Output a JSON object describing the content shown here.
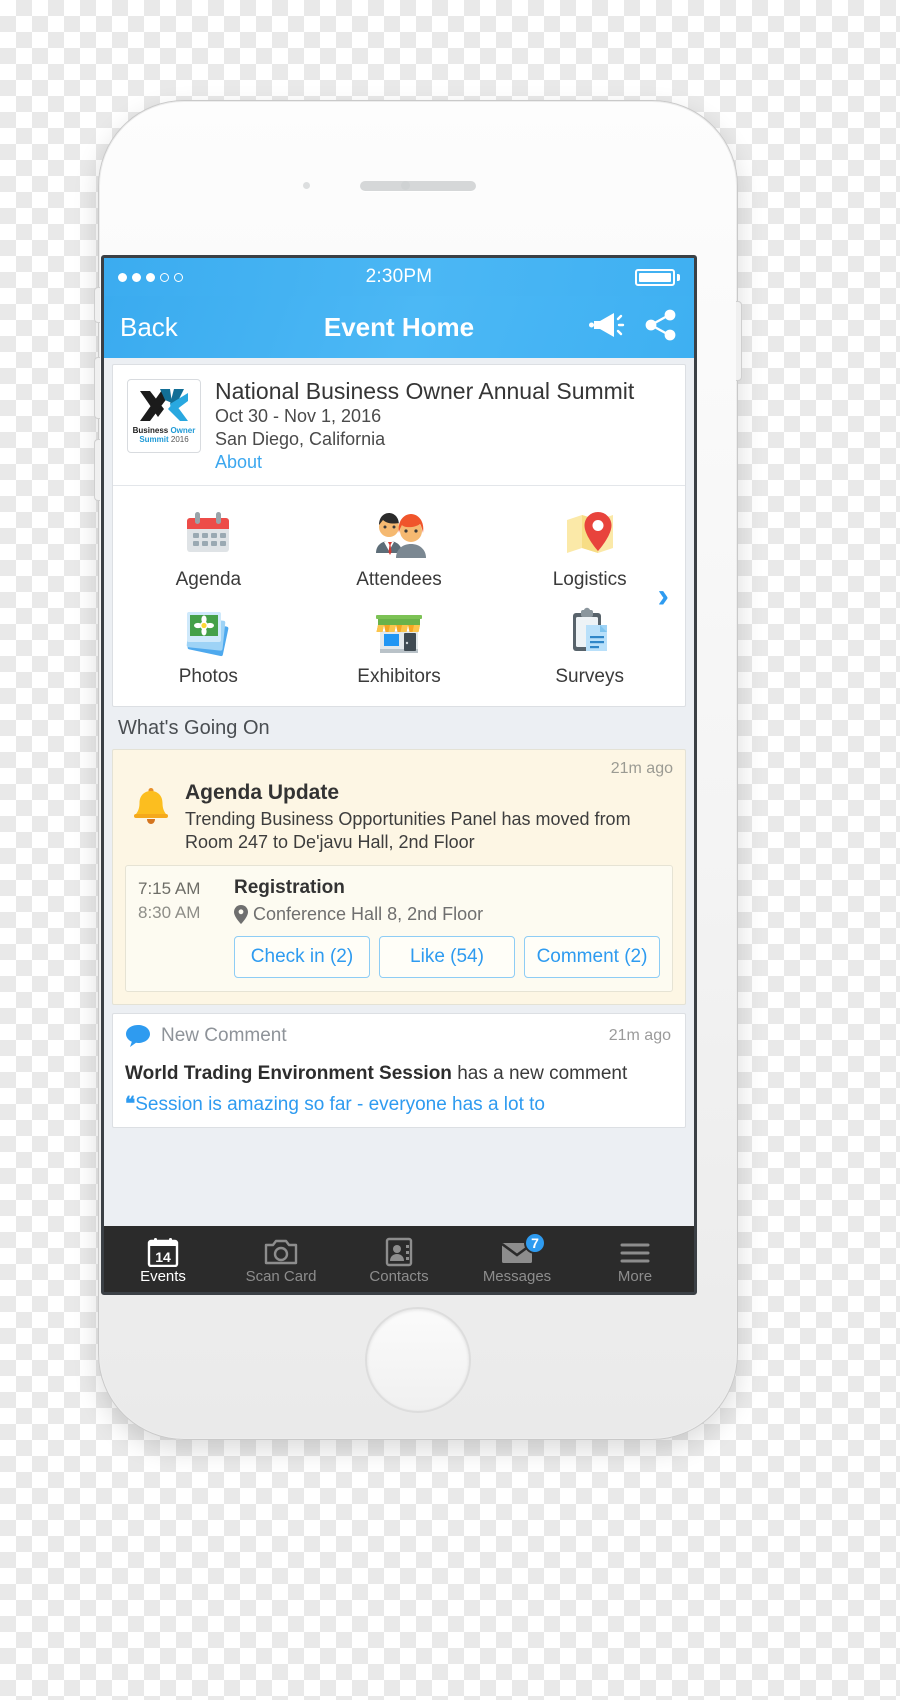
{
  "status_bar": {
    "signal_dots_filled": 3,
    "signal_dots_total": 5,
    "time": "2:30PM",
    "battery_icon": "battery-full-icon"
  },
  "nav_bar": {
    "back_label": "Back",
    "title": "Event Home",
    "announce_icon": "megaphone-icon",
    "share_icon": "share-icon"
  },
  "event": {
    "logo": {
      "icon": "business-owner-summit-logo",
      "word_business": "Business",
      "word_owner": "Owner",
      "word_summit": "Summit",
      "word_year": "2016"
    },
    "title": "National Business Owner Annual Summit",
    "dates": "Oct 30 - Nov 1, 2016",
    "location": "San Diego, California",
    "about_link": "About"
  },
  "icon_grid": {
    "next_arrow": "chevron-right-icon",
    "items": [
      {
        "label": "Agenda",
        "icon": "calendar-icon"
      },
      {
        "label": "Attendees",
        "icon": "people-icon"
      },
      {
        "label": "Logistics",
        "icon": "map-pin-icon"
      },
      {
        "label": "Photos",
        "icon": "photos-icon"
      },
      {
        "label": "Exhibitors",
        "icon": "storefront-icon"
      },
      {
        "label": "Surveys",
        "icon": "clipboard-icon"
      }
    ]
  },
  "feed": {
    "section_title": "What's Going On",
    "alert": {
      "icon": "bell-icon",
      "time_ago": "21m ago",
      "title": "Agenda Update",
      "text": "Trending Business Opportunities Panel has moved from Room 247 to De'javu Hall, 2nd Floor",
      "session": {
        "start_time": "7:15 AM",
        "end_time": "8:30 AM",
        "title": "Registration",
        "location_icon": "location-pin-icon",
        "location": "Conference Hall 8, 2nd Floor",
        "actions": [
          {
            "label": "Check in (2)"
          },
          {
            "label": "Like (54)"
          },
          {
            "label": "Comment (2)"
          }
        ]
      }
    },
    "comment": {
      "icon": "speech-bubble-icon",
      "kind": "New Comment",
      "time_ago": "21m ago",
      "subject": "World Trading Environment Session",
      "suffix": " has a new comment",
      "quote_mark": "❝",
      "quote": "Session is amazing so far - everyone has a lot to"
    }
  },
  "tab_bar": {
    "tabs": [
      {
        "label": "Events",
        "icon": "calendar-14-icon",
        "active": true,
        "badge": ""
      },
      {
        "label": "Scan Card",
        "icon": "camera-icon",
        "active": false,
        "badge": ""
      },
      {
        "label": "Contacts",
        "icon": "contact-card-icon",
        "active": false,
        "badge": ""
      },
      {
        "label": "Messages",
        "icon": "envelope-icon",
        "active": false,
        "badge": "7"
      },
      {
        "label": "More",
        "icon": "hamburger-icon",
        "active": false,
        "badge": ""
      }
    ],
    "events_day_number": "14"
  },
  "colors": {
    "accent_blue": "#3bacf0",
    "link_blue": "#2e9bf0",
    "alert_bg": "#fdf6e4",
    "tabbar_bg": "#2b2b2b",
    "badge_blue": "#2e9bf0"
  }
}
